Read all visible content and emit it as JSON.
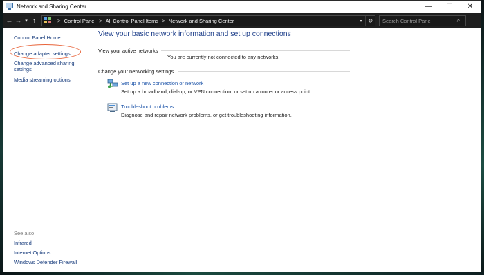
{
  "window": {
    "title": "Network and Sharing Center",
    "controls": {
      "minimize": "—",
      "maximize": "☐",
      "close": "✕"
    }
  },
  "navigation": {
    "back_icon": "←",
    "forward_icon": "→",
    "recent_icon": "▾",
    "up_icon": "↑",
    "breadcrumbs": [
      "Control Panel",
      "All Control Panel Items",
      "Network and Sharing Center"
    ],
    "separator": ">",
    "dropdown_icon": "▾",
    "refresh_icon": "↻",
    "search_placeholder": "Search Control Panel",
    "search_icon": "⌕"
  },
  "sidebar": {
    "home": "Control Panel Home",
    "links": [
      "Change adapter settings",
      "Change advanced sharing settings",
      "Media streaming options"
    ],
    "highlight_color": "#e8643a",
    "see_also_label": "See also",
    "see_also": [
      "Infrared",
      "Internet Options",
      "Windows Defender Firewall"
    ]
  },
  "main": {
    "title": "View your basic network information and set up connections",
    "active_networks_label": "View your active networks",
    "active_networks_status": "You are currently not connected to any networks.",
    "settings_label": "Change your networking settings",
    "tasks": [
      {
        "icon": "network-setup-icon",
        "link": "Set up a new connection or network",
        "desc": "Set up a broadband, dial-up, or VPN connection; or set up a router or access point."
      },
      {
        "icon": "troubleshoot-icon",
        "link": "Troubleshoot problems",
        "desc": "Diagnose and repair network problems, or get troubleshooting information."
      }
    ]
  }
}
